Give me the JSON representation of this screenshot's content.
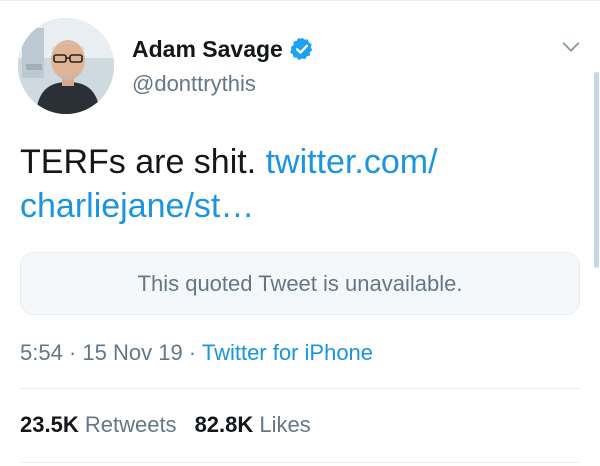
{
  "tweet": {
    "author": {
      "display_name": "Adam Savage",
      "handle": "@donttrythis",
      "verified_icon": "verified-badge-icon",
      "verified_color": "#1da1f2"
    },
    "text": {
      "plain": "TERFs are shit. ",
      "link_line1": "twitter.com/",
      "link_line2": "charliejane/st…"
    },
    "quoted_tweet": {
      "message": "This quoted Tweet is unavailable."
    },
    "meta": {
      "time": "5:54",
      "separator": " · ",
      "date": "15 Nov 19",
      "source": "Twitter for iPhone"
    },
    "stats": {
      "retweets_count": "23.5K",
      "retweets_label": "Retweets",
      "likes_count": "82.8K",
      "likes_label": "Likes"
    }
  },
  "colors": {
    "link": "#1b95e0",
    "secondary_text": "#657786",
    "primary_text": "#14171a"
  }
}
